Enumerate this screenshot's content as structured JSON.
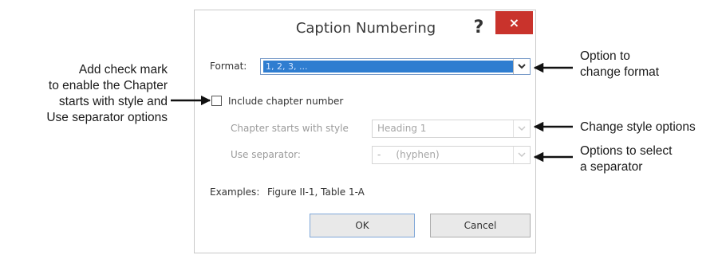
{
  "annotations": {
    "left": [
      "Add check mark",
      "to enable the Chapter",
      "starts with style and",
      "Use separator  options"
    ],
    "format": [
      "Option to",
      "change format"
    ],
    "style": [
      "Change style options"
    ],
    "separator": [
      "Options to select",
      "a separator"
    ]
  },
  "dialog": {
    "title": "Caption Numbering",
    "help_icon": "?",
    "close_icon": "×",
    "format_label": "Format:",
    "format_value": "1, 2, 3, ...",
    "include_chapter_label": "Include chapter number",
    "include_chapter_checked": false,
    "chapter_style_label": "Chapter starts with style",
    "chapter_style_value": "Heading 1",
    "separator_label": "Use separator:",
    "separator_value": "-     (hyphen)",
    "examples_label": "Examples:",
    "examples_value": "Figure II-1, Table 1-A",
    "ok_label": "OK",
    "cancel_label": "Cancel"
  },
  "colors": {
    "close_button": "#c9332c",
    "format_selection": "#2f7dd0",
    "disabled_text": "#9a9a9a"
  }
}
